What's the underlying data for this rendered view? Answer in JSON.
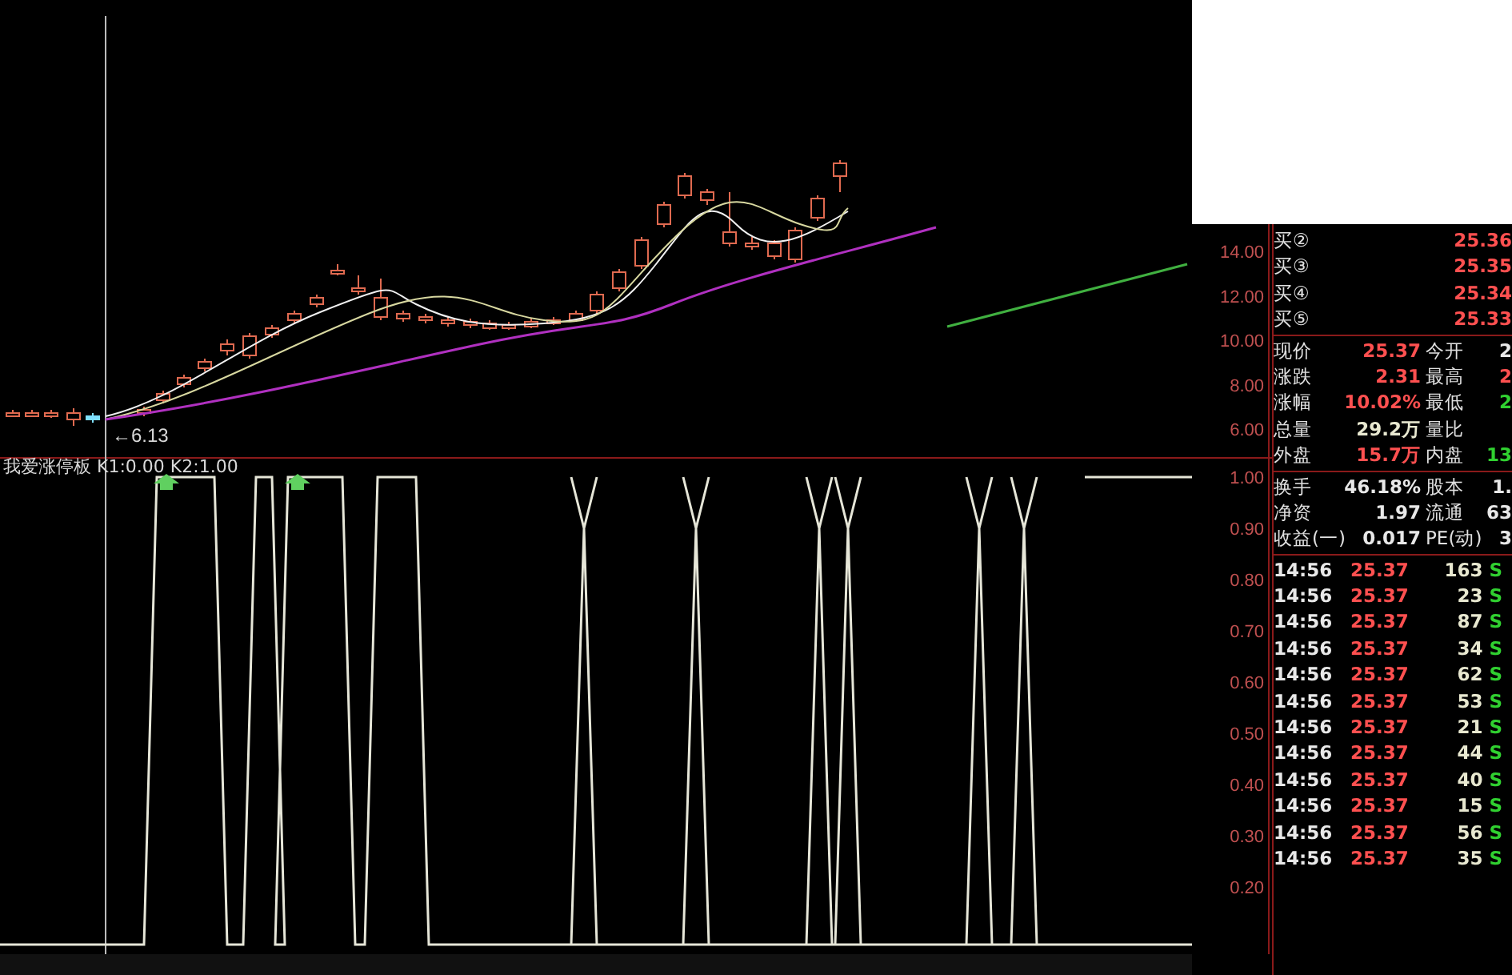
{
  "chart": {
    "price_marker": "←6.13",
    "indicator_title": "我爱涨停板 K1:0.00 K2:1.00",
    "price_axis": [
      "14.00",
      "12.00",
      "10.00",
      "8.00",
      "6.00"
    ],
    "indicator_axis": [
      "1.00",
      "0.90",
      "0.80",
      "0.70",
      "0.60",
      "0.50",
      "0.40",
      "0.30",
      "0.20"
    ]
  },
  "quote": {
    "bids": [
      {
        "label": "买②",
        "price": "25.36"
      },
      {
        "label": "买③",
        "price": "25.35"
      },
      {
        "label": "买④",
        "price": "25.34"
      },
      {
        "label": "买⑤",
        "price": "25.33"
      }
    ],
    "stats": [
      {
        "cells": [
          {
            "label": "现价",
            "value": "25.37",
            "color": "#ff5050"
          },
          {
            "label": "今开",
            "value": "2",
            "color": "#e8e8e8"
          }
        ]
      },
      {
        "cells": [
          {
            "label": "涨跌",
            "value": "2.31",
            "color": "#ff5050"
          },
          {
            "label": "最高",
            "value": "2",
            "color": "#ff5050"
          }
        ]
      },
      {
        "cells": [
          {
            "label": "涨幅",
            "value": "10.02%",
            "color": "#ff5050"
          },
          {
            "label": "最低",
            "value": "2",
            "color": "#30d030"
          }
        ]
      },
      {
        "cells": [
          {
            "label": "总量",
            "value": "29.2万",
            "color": "#e8e8d0"
          },
          {
            "label": "量比"
          }
        ]
      },
      {
        "cells": [
          {
            "label": "外盘",
            "value": "15.7万",
            "color": "#ff5050"
          },
          {
            "label": "内盘",
            "value": "13",
            "color": "#30d030"
          }
        ]
      }
    ],
    "stats2": [
      {
        "label": "换手",
        "value": "46.18%",
        "label2": "股本",
        "value2": "1."
      },
      {
        "label": "净资",
        "value": "1.97",
        "label2": "流通",
        "value2": "63"
      },
      {
        "label": "收益(一)",
        "value": "0.017",
        "label2": "PE(动)",
        "value2": "3"
      }
    ],
    "trades": [
      {
        "time": "14:56",
        "price": "25.37",
        "volume": "163",
        "side": "S"
      },
      {
        "time": "14:56",
        "price": "25.37",
        "volume": "23",
        "side": "S"
      },
      {
        "time": "14:56",
        "price": "25.37",
        "volume": "87",
        "side": "S"
      },
      {
        "time": "14:56",
        "price": "25.37",
        "volume": "34",
        "side": "S"
      },
      {
        "time": "14:56",
        "price": "25.37",
        "volume": "62",
        "side": "S"
      },
      {
        "time": "14:56",
        "price": "25.37",
        "volume": "53",
        "side": "S"
      },
      {
        "time": "14:56",
        "price": "25.37",
        "volume": "21",
        "side": "S"
      },
      {
        "time": "14:56",
        "price": "25.37",
        "volume": "44",
        "side": "S"
      },
      {
        "time": "14:56",
        "price": "25.37",
        "volume": "40",
        "side": "S"
      },
      {
        "time": "14:56",
        "price": "25.37",
        "volume": "15",
        "side": "S"
      },
      {
        "time": "14:56",
        "price": "25.37",
        "volume": "56",
        "side": "S"
      },
      {
        "time": "14:56",
        "price": "25.37",
        "volume": "35",
        "side": "S"
      }
    ]
  }
}
